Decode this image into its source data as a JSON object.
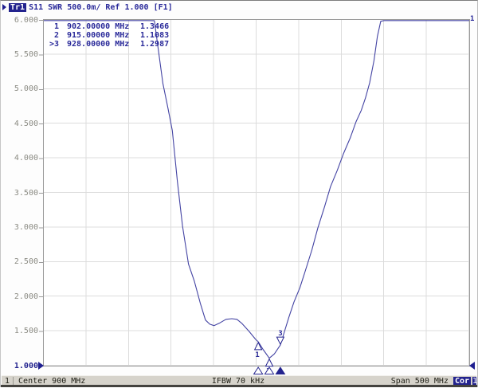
{
  "header": {
    "trace_badge": "Tr1",
    "title": "S11 SWR 500.0m/ Ref 1.000 [F1]",
    "trace_end_label": "1"
  },
  "marker_table": {
    "rows": [
      {
        "prefix": "",
        "n": "1",
        "freq": "902.00000 MHz",
        "value": "1.3466"
      },
      {
        "prefix": "",
        "n": "2",
        "freq": "915.00000 MHz",
        "value": "1.1083"
      },
      {
        "prefix": ">",
        "n": "3",
        "freq": "928.00000 MHz",
        "value": "1.2987"
      }
    ]
  },
  "axis": {
    "y_ticks": [
      "6.000",
      "5.500",
      "5.000",
      "4.500",
      "4.000",
      "3.500",
      "3.000",
      "2.500",
      "2.000",
      "1.500",
      "1.000"
    ],
    "ref_value": "1.000",
    "y_min": 1.0,
    "y_max": 6.0,
    "x_min_mhz": 650,
    "x_max_mhz": 1150
  },
  "chart_data": {
    "type": "line",
    "title": "Tr1 S11 SWR 500.0m/ Ref 1.000",
    "xlabel": "Frequency (MHz), Center 900 MHz, Span 500 MHz",
    "ylabel": "SWR",
    "x_range_mhz": [
      650,
      1150
    ],
    "ylim": [
      1.0,
      6.0
    ],
    "grid": true,
    "series": [
      {
        "name": "Tr1 S11 SWR",
        "points": [
          [
            650,
            6.0
          ],
          [
            770,
            6.0
          ],
          [
            780,
            5.99
          ],
          [
            790,
            5.08
          ],
          [
            796,
            4.72
          ],
          [
            801,
            4.4
          ],
          [
            807,
            3.66
          ],
          [
            813,
            3.02
          ],
          [
            820,
            2.47
          ],
          [
            827,
            2.22
          ],
          [
            834,
            1.9
          ],
          [
            840,
            1.66
          ],
          [
            845,
            1.6
          ],
          [
            850,
            1.58
          ],
          [
            857,
            1.62
          ],
          [
            864,
            1.67
          ],
          [
            871,
            1.68
          ],
          [
            877,
            1.67
          ],
          [
            883,
            1.61
          ],
          [
            891,
            1.5
          ],
          [
            899,
            1.38
          ],
          [
            902,
            1.3466
          ],
          [
            908,
            1.23
          ],
          [
            915,
            1.1083
          ],
          [
            921,
            1.17
          ],
          [
            928,
            1.2987
          ],
          [
            934,
            1.54
          ],
          [
            938,
            1.7
          ],
          [
            944,
            1.92
          ],
          [
            951,
            2.13
          ],
          [
            957,
            2.36
          ],
          [
            965,
            2.67
          ],
          [
            972,
            2.99
          ],
          [
            980,
            3.3
          ],
          [
            987,
            3.59
          ],
          [
            995,
            3.83
          ],
          [
            1002,
            4.06
          ],
          [
            1010,
            4.29
          ],
          [
            1017,
            4.53
          ],
          [
            1023,
            4.69
          ],
          [
            1028,
            4.87
          ],
          [
            1033,
            5.09
          ],
          [
            1038,
            5.41
          ],
          [
            1042,
            5.76
          ],
          [
            1046,
            5.98
          ],
          [
            1050,
            6.0
          ],
          [
            1150,
            6.0
          ]
        ]
      }
    ],
    "markers": [
      {
        "n": "1",
        "freq_mhz": 902.0,
        "swr": 1.3466,
        "glyph": "below",
        "active": false
      },
      {
        "n": "2",
        "freq_mhz": 915.0,
        "swr": 1.1083,
        "glyph": "below",
        "active": false
      },
      {
        "n": "3",
        "freq_mhz": 928.0,
        "swr": 1.2987,
        "glyph": "above",
        "active": true
      }
    ]
  },
  "status_bar": {
    "channel": "1",
    "center_label": "Center 900 MHz",
    "ifbw_label": "IFBW 70 kHz",
    "span_label": "Span 500 MHz",
    "cor_badge": "Cor",
    "edge_clipped": "1"
  },
  "colors": {
    "accent_navy": "#2a2a9a",
    "badge_navy": "#23238e",
    "trace": "#4343a3",
    "grid": "#dcdcdc",
    "frame": "#9a9a9a",
    "tick_label": "#8b8b83",
    "status_bg": "#d6d3cb"
  }
}
